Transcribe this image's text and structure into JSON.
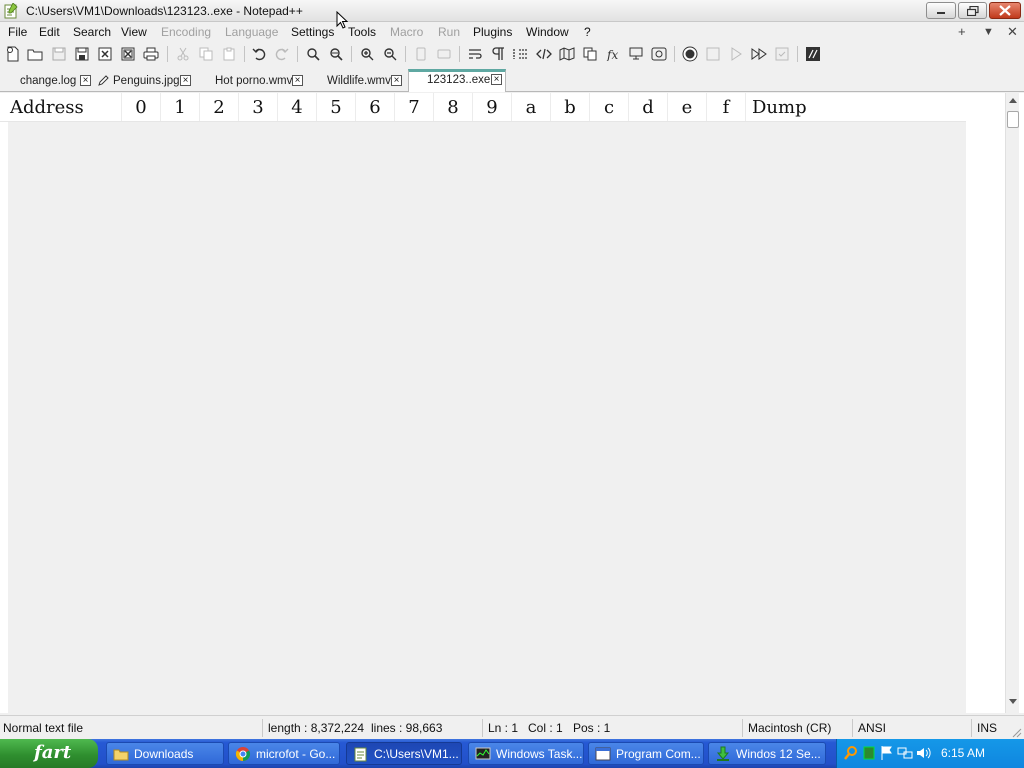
{
  "window": {
    "title": "C:\\Users\\VM1\\Downloads\\123123..exe - Notepad++"
  },
  "menu": {
    "items": [
      {
        "label": "File",
        "enabled": true
      },
      {
        "label": "Edit",
        "enabled": true
      },
      {
        "label": "Search",
        "enabled": true
      },
      {
        "label": "View",
        "enabled": true
      },
      {
        "label": "Encoding",
        "enabled": false
      },
      {
        "label": "Language",
        "enabled": false
      },
      {
        "label": "Settings",
        "enabled": true
      },
      {
        "label": "Tools",
        "enabled": true
      },
      {
        "label": "Macro",
        "enabled": false
      },
      {
        "label": "Run",
        "enabled": false
      },
      {
        "label": "Plugins",
        "enabled": true
      },
      {
        "label": "Window",
        "enabled": true
      },
      {
        "label": "?",
        "enabled": true
      }
    ],
    "right": [
      "+",
      "▼",
      "✕"
    ]
  },
  "toolbar": {
    "icons": [
      "new-file-icon",
      "open-file-icon",
      "save-icon",
      "save-all-icon",
      "close-icon",
      "close-all-icon",
      "print-icon",
      "cut-icon",
      "copy-icon",
      "paste-icon",
      "undo-icon",
      "redo-icon",
      "find-icon",
      "replace-icon",
      "zoom-in-icon",
      "zoom-out-icon",
      "sync-vertical-icon",
      "sync-horizontal-icon",
      "word-wrap-icon",
      "show-all-chars-icon",
      "indent-guide-icon",
      "xml-tag-icon",
      "document-map-icon",
      "clone-icon",
      "function-list-icon",
      "monitor-icon",
      "snapshot-icon",
      "record-macro-icon",
      "stop-record-icon",
      "play-macro-icon",
      "run-macro-multiple-icon",
      "save-macro-icon",
      "hex-editor-icon"
    ]
  },
  "tabs": [
    {
      "label": "change.log",
      "active": false
    },
    {
      "label": "Penguins.jpg",
      "active": false,
      "modified_icon": "pencil-icon"
    },
    {
      "label": "Hot porno.wmv",
      "active": false
    },
    {
      "label": "Wildlife.wmv",
      "active": false
    },
    {
      "label": "123123..exe",
      "active": true
    }
  ],
  "hex_header": {
    "address": "Address",
    "columns": [
      "0",
      "1",
      "2",
      "3",
      "4",
      "5",
      "6",
      "7",
      "8",
      "9",
      "a",
      "b",
      "c",
      "d",
      "e",
      "f"
    ],
    "dump": "Dump"
  },
  "status": {
    "file_type": "Normal text file",
    "length": "length : 8,372,224",
    "lines": "lines : 98,663",
    "ln": "Ln : 1",
    "col": "Col : 1",
    "pos": "Pos : 1",
    "eol": "Macintosh (CR)",
    "encoding": "ANSI",
    "mode": "INS"
  },
  "taskbar": {
    "start_label": "fart",
    "tasks": [
      {
        "label": "Downloads",
        "icon": "folder-icon",
        "active": false
      },
      {
        "label": "microfot - Go...",
        "icon": "chrome-icon",
        "active": false
      },
      {
        "label": "C:\\Users\\VM1...",
        "icon": "notepadpp-icon",
        "active": true
      },
      {
        "label": "Windows Task...",
        "icon": "task-manager-icon",
        "active": false
      },
      {
        "label": "Program Com...",
        "icon": "window-icon",
        "active": false
      },
      {
        "label": "Windos 12 Se...",
        "icon": "download-icon",
        "active": false
      }
    ],
    "clock": "6:15 AM"
  },
  "colors": {
    "accent_tab": "#5fa8a2",
    "taskbar_blue": "#2250c9",
    "start_green": "#2f8f2f",
    "tray_blue": "#1598e8"
  }
}
